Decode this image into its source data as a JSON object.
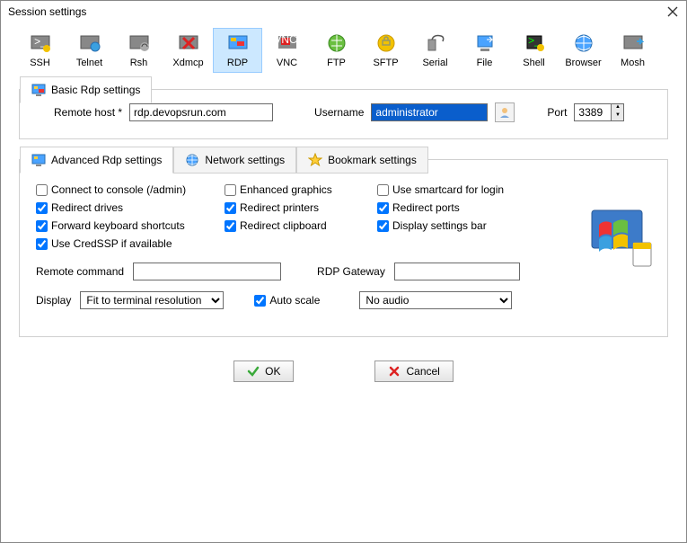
{
  "window": {
    "title": "Session settings"
  },
  "sessionTypes": {
    "items": [
      {
        "label": "SSH"
      },
      {
        "label": "Telnet"
      },
      {
        "label": "Rsh"
      },
      {
        "label": "Xdmcp"
      },
      {
        "label": "RDP"
      },
      {
        "label": "VNC"
      },
      {
        "label": "FTP"
      },
      {
        "label": "SFTP"
      },
      {
        "label": "Serial"
      },
      {
        "label": "File"
      },
      {
        "label": "Shell"
      },
      {
        "label": "Browser"
      },
      {
        "label": "Mosh"
      }
    ],
    "selectedIndex": 4
  },
  "basic": {
    "tabLabel": "Basic Rdp settings",
    "remoteHostLabel": "Remote host *",
    "remoteHostValue": "rdp.devopsrun.com",
    "usernameLabel": "Username",
    "usernameValue": "administrator",
    "portLabel": "Port",
    "portValue": "3389"
  },
  "advTabs": {
    "adv": "Advanced Rdp settings",
    "net": "Network settings",
    "bookmark": "Bookmark settings"
  },
  "adv": {
    "checks": [
      {
        "label": "Connect to console (/admin)",
        "checked": false
      },
      {
        "label": "Enhanced graphics",
        "checked": false
      },
      {
        "label": "Use smartcard for login",
        "checked": false
      },
      {
        "label": "Redirect drives",
        "checked": true
      },
      {
        "label": "Redirect printers",
        "checked": true
      },
      {
        "label": "Redirect ports",
        "checked": true
      },
      {
        "label": "Forward keyboard shortcuts",
        "checked": true
      },
      {
        "label": "Redirect clipboard",
        "checked": true
      },
      {
        "label": "Display settings bar",
        "checked": true
      },
      {
        "label": "Use CredSSP if available",
        "checked": true
      }
    ],
    "remoteCmdLabel": "Remote command",
    "remoteCmdValue": "",
    "gatewayLabel": "RDP Gateway",
    "gatewayValue": "",
    "displayLabel": "Display",
    "displayOption": "Fit to terminal resolution",
    "autoScaleLabel": "Auto scale",
    "autoScaleChecked": true,
    "audioOption": "No audio"
  },
  "buttons": {
    "ok": "OK",
    "cancel": "Cancel"
  }
}
